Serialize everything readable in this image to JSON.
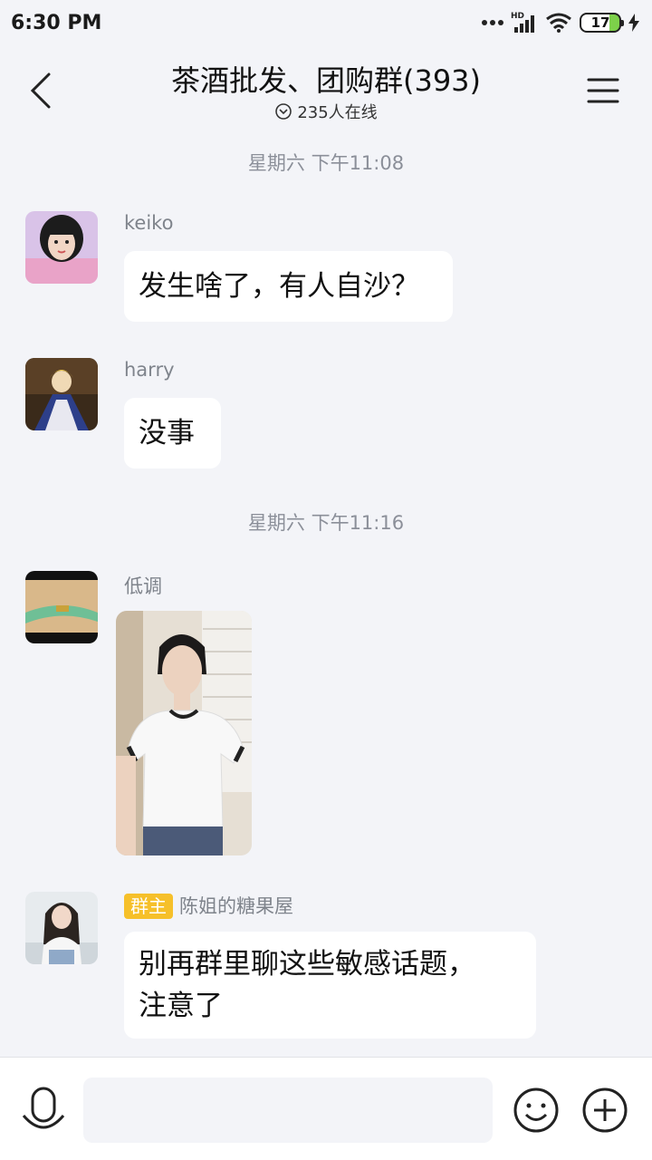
{
  "status_bar": {
    "time": "6:30 PM",
    "battery": "17"
  },
  "header": {
    "title": "茶酒批发、团购群(393)",
    "online": "235人在线"
  },
  "timestamps": [
    "星期六 下午11:08",
    "星期六 下午11:16"
  ],
  "messages": [
    {
      "name": "keiko",
      "text": "发生啥了，有人自沙？"
    },
    {
      "name": "harry",
      "text": "没事"
    },
    {
      "name": "低调",
      "text": ""
    },
    {
      "name": "陈姐的糖果屋",
      "badge": "群主",
      "text": "别再群里聊这些敏感话题，\n注意了"
    }
  ]
}
